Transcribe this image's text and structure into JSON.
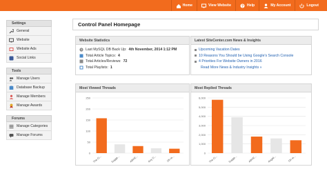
{
  "topnav": [
    {
      "icon": "home-icon",
      "label": "Home"
    },
    {
      "icon": "monitor-icon",
      "label": "View Website"
    },
    {
      "icon": "help-icon",
      "label": "Help"
    },
    {
      "icon": "user-icon",
      "label": "My Account"
    },
    {
      "icon": "logout-icon",
      "label": "Logout"
    }
  ],
  "sidebar": {
    "groups": [
      {
        "heading": "Settings",
        "items": [
          {
            "icon": "wrench-icon",
            "label": "General"
          },
          {
            "icon": "monitor-icon",
            "label": "Website"
          },
          {
            "icon": "ads-icon",
            "label": "Website Ads"
          },
          {
            "icon": "share-icon",
            "label": "Social Links"
          }
        ]
      },
      {
        "heading": "Tools",
        "items": [
          {
            "icon": "users-icon",
            "label": "Manage Users"
          },
          {
            "icon": "database-icon",
            "label": "Database Backup"
          },
          {
            "icon": "members-icon",
            "label": "Manage Members"
          },
          {
            "icon": "award-icon",
            "label": "Manage Awards"
          }
        ]
      },
      {
        "heading": "Forums",
        "items": [
          {
            "icon": "categories-icon",
            "label": "Manage Categories"
          },
          {
            "icon": "forums-icon",
            "label": "Manage Forums"
          }
        ]
      }
    ]
  },
  "main": {
    "page_title": "Control Panel Homepage",
    "stats": {
      "heading": "Website Statistics",
      "rows": [
        {
          "label": "Last MySQL DB Back Up:",
          "value": "4th November, 2014 1:12 PM"
        },
        {
          "label": "Total Article Topics:",
          "value": "4"
        },
        {
          "label": "Total Articles/Reviews:",
          "value": "72"
        },
        {
          "label": "Total Playlists:",
          "value": "1"
        }
      ]
    },
    "news": {
      "heading": "Latest SiteCenter.com News & Insights",
      "items": [
        "Upcoming Vacation Dates",
        "10 Reasons You Should be Using Google's Search Console",
        "4 Priorities For Website Owners in 2016"
      ],
      "more_link": "Read More News & Industry Insights »"
    }
  },
  "colors": {
    "accent": "#f26b1d",
    "bar": "#f26b1d",
    "bar_muted": "#e6e6e6"
  },
  "chart_data": [
    {
      "type": "bar",
      "title": "Most Viewed Threads",
      "categories": [
        "The Ci...",
        "Sugge...",
        "ABHE...",
        "Any D...",
        "Oh m..."
      ],
      "values": [
        158,
        40,
        32,
        22,
        20
      ],
      "highlight": [
        true,
        false,
        true,
        false,
        true
      ],
      "yticks": [
        "250",
        "200",
        "150",
        "100",
        "50",
        "0"
      ],
      "ylim": [
        0,
        250
      ],
      "grid": true
    },
    {
      "type": "bar",
      "title": "Most Replied Threads",
      "categories": [
        "The Ci...",
        "Sugge...",
        "ABHE...",
        "Angeli...",
        "Oh m..."
      ],
      "values": [
        5800,
        3900,
        1800,
        1600,
        1400
      ],
      "highlight": [
        true,
        false,
        true,
        false,
        true
      ],
      "yticks": [
        "6,000",
        "5,000",
        "4,000",
        "3,000",
        "2,000",
        "1,000",
        "0"
      ],
      "ylim": [
        0,
        6000
      ],
      "grid": true
    }
  ]
}
